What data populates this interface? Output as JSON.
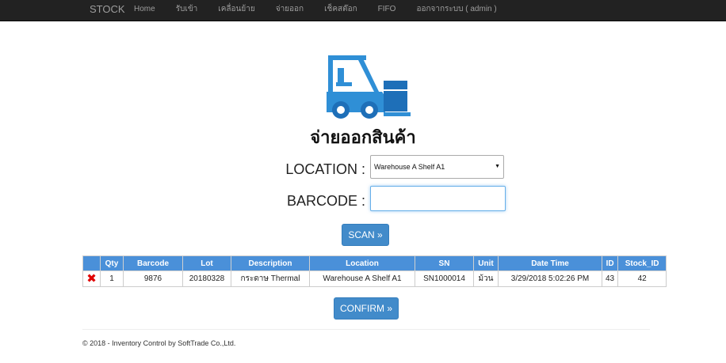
{
  "nav": {
    "brand": "STOCK",
    "links": [
      "Home",
      "รับเข้า",
      "เคลื่อนย้าย",
      "จ่ายออก",
      "เช็คสต๊อก",
      "FIFO",
      "ออกจากระบบ ( admin )"
    ]
  },
  "page": {
    "title": "จ่ายออกสินค้า",
    "icon": "forklift-icon"
  },
  "form": {
    "location_label": "LOCATION :",
    "location_value": "Warehouse A Shelf A1",
    "barcode_label": "BARCODE :",
    "barcode_value": "",
    "scan_button": "SCAN »"
  },
  "table": {
    "headers": [
      "",
      "Qty",
      "Barcode",
      "Lot",
      "Description",
      "Location",
      "SN",
      "Unit",
      "Date Time",
      "ID",
      "Stock_ID"
    ],
    "rows": [
      [
        "",
        "1",
        "9876",
        "20180328",
        "กระดาษ Thermal",
        "Warehouse A Shelf A1",
        "SN1000014",
        "ม้วน",
        "3/29/2018 5:02:26 PM",
        "43",
        "42"
      ]
    ]
  },
  "confirm_button": "CONFIRM »",
  "footer": "© 2018 - Inventory Control by SoftTrade Co.,Ltd.",
  "colors": {
    "navbar": "#222222",
    "primary": "#428bca",
    "table_header": "#4a90d9",
    "delete": "#e00000"
  }
}
